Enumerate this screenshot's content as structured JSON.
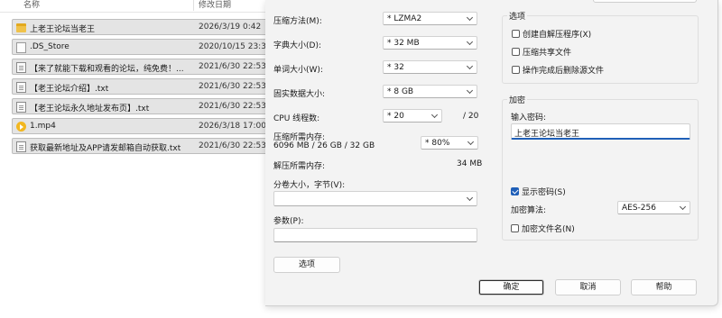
{
  "explorer": {
    "col_name": "名称",
    "col_date": "修改日期",
    "files": [
      {
        "icon": "folder-icon",
        "name": "上老王论坛当老王",
        "date": "2026/3/19 0:42"
      },
      {
        "icon": "file-icon",
        "name": ".DS_Store",
        "date": "2020/10/15 23:3"
      },
      {
        "icon": "text-file-icon",
        "name": "【来了就能下载和观看的论坛，纯免费！...",
        "date": "2021/6/30 22:53"
      },
      {
        "icon": "text-file-icon",
        "name": "【老王论坛介绍】.txt",
        "date": "2021/6/30 22:53"
      },
      {
        "icon": "text-file-icon",
        "name": "【老王论坛永久地址发布页】.txt",
        "date": "2021/6/30 22:53"
      },
      {
        "icon": "video-file-icon",
        "name": "1.mp4",
        "date": "2026/3/18 17:00"
      },
      {
        "icon": "text-file-icon",
        "name": "获取最新地址及APP请发邮箱自动获取.txt",
        "date": "2021/6/30 22:53"
      }
    ]
  },
  "dialog": {
    "compress_method": {
      "label": "压缩方法(M):",
      "value": "* LZMA2"
    },
    "dict_size": {
      "label": "字典大小(D):",
      "value": "* 32 MB"
    },
    "word_size": {
      "label": "单词大小(W):",
      "value": "* 32"
    },
    "solid_block": {
      "label": "固实数据大小:",
      "value": "* 8 GB"
    },
    "cpu_threads": {
      "label": "CPU 线程数:",
      "value": "* 20",
      "max": "/ 20"
    },
    "memory_compress": {
      "label": "压缩所需内存:",
      "detail": "6096 MB / 26 GB / 32 GB",
      "value": "* 80%"
    },
    "memory_decompress": {
      "label": "解压所需内存:",
      "value": "34 MB"
    },
    "split_volume": {
      "label": "分卷大小，字节(V):",
      "value": ""
    },
    "params": {
      "label": "参数(P):",
      "value": ""
    },
    "options_button": "选项",
    "options_group": {
      "title": "选项",
      "sfx": {
        "label": "创建自解压程序(X)",
        "checked": false
      },
      "shared": {
        "label": "压缩共享文件",
        "checked": false
      },
      "delete_after": {
        "label": "操作完成后删除源文件",
        "checked": false
      }
    },
    "encryption": {
      "title": "加密",
      "password_label": "输入密码:",
      "password_value": "上老王论坛当老王",
      "show_password": {
        "label": "显示密码(S)",
        "checked": true
      },
      "method_label": "加密算法:",
      "method_value": "AES-256",
      "encrypt_names": {
        "label": "加密文件名(N)",
        "checked": false
      }
    },
    "buttons": {
      "ok": "确定",
      "cancel": "取消",
      "help": "帮助"
    },
    "accent_color": "#1f5fb8"
  }
}
